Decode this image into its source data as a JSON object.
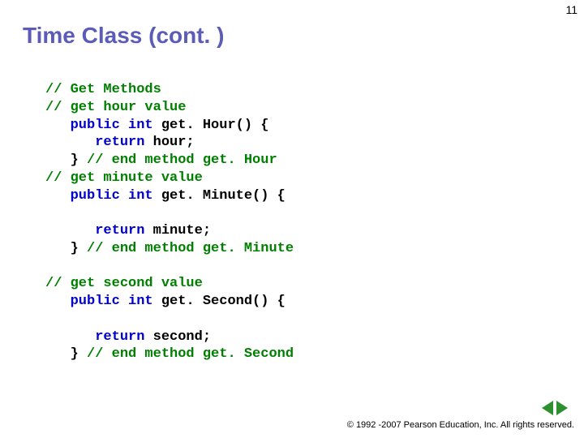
{
  "page_number": "11",
  "title": "Time Class (cont. )",
  "code": {
    "l1": "// Get Methods",
    "l2": "// get hour value",
    "l3a": "   public",
    "l3b": " int",
    "l3c": " get. Hour() {",
    "l4a": "      return",
    "l4b": " hour;",
    "l5a": "   } ",
    "l5b": "// end method get. Hour",
    "l6": "// get minute value",
    "l7a": "   public",
    "l7b": " int",
    "l7c": " get. Minute() {",
    "l8": "",
    "l9a": "      return",
    "l9b": " minute;",
    "l10a": "   } ",
    "l10b": "// end method get. Minute",
    "l11": "",
    "l12": "// get second value",
    "l13a": "   public",
    "l13b": " int",
    "l13c": " get. Second() {",
    "l14": "",
    "l15a": "      return",
    "l15b": " second;",
    "l16a": "   } ",
    "l16b": "// end method get. Second"
  },
  "footer": "© 1992 -2007 Pearson Education, Inc.  All rights reserved."
}
